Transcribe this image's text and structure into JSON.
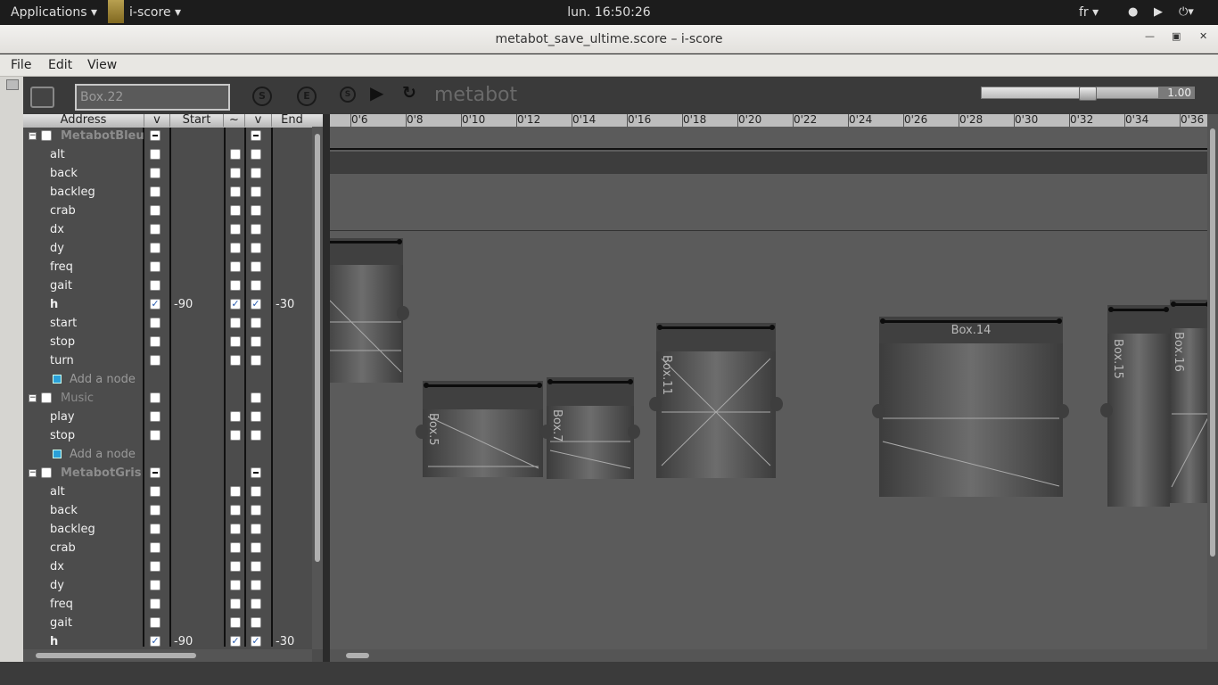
{
  "topbar": {
    "applications": "Applications ▾",
    "app_name": "i-score ▾",
    "clock": "lun. 16:50:26",
    "lang": "fr ▾",
    "icons": [
      "wifi-icon",
      "volume-icon",
      "power-icon"
    ]
  },
  "window": {
    "title": "metabot_save_ultime.score – i-score"
  },
  "menu": {
    "file": "File",
    "edit": "Edit",
    "view": "View"
  },
  "toolbar": {
    "box_name": "Box.22",
    "start_button": "S",
    "end_button": "E",
    "stop_button": "S",
    "project_title": "metabot",
    "zoom_value": "1.00",
    "zoom_level": 0.6
  },
  "tree": {
    "headers": {
      "address": "Address",
      "v1": "v",
      "start": "Start",
      "tilde": "~",
      "v2": "v",
      "end": "End"
    },
    "rows": [
      {
        "label": "MetabotBleu",
        "kind": "parent"
      },
      {
        "label": "alt",
        "kind": "child"
      },
      {
        "label": "back",
        "kind": "child"
      },
      {
        "label": "backleg",
        "kind": "child"
      },
      {
        "label": "crab",
        "kind": "child"
      },
      {
        "label": "dx",
        "kind": "child"
      },
      {
        "label": "dy",
        "kind": "child"
      },
      {
        "label": "freq",
        "kind": "child"
      },
      {
        "label": "gait",
        "kind": "child"
      },
      {
        "label": "h",
        "kind": "child-checked",
        "start": "-90",
        "end": "-30"
      },
      {
        "label": "start",
        "kind": "child"
      },
      {
        "label": "stop",
        "kind": "child"
      },
      {
        "label": "turn",
        "kind": "child"
      },
      {
        "label": "Add a node",
        "kind": "add"
      },
      {
        "label": "Music",
        "kind": "music"
      },
      {
        "label": "play",
        "kind": "child"
      },
      {
        "label": "stop",
        "kind": "child"
      },
      {
        "label": "Add a node",
        "kind": "add"
      },
      {
        "label": "MetabotGris",
        "kind": "parent"
      },
      {
        "label": "alt",
        "kind": "child"
      },
      {
        "label": "back",
        "kind": "child"
      },
      {
        "label": "backleg",
        "kind": "child"
      },
      {
        "label": "crab",
        "kind": "child"
      },
      {
        "label": "dx",
        "kind": "child"
      },
      {
        "label": "dy",
        "kind": "child"
      },
      {
        "label": "freq",
        "kind": "child"
      },
      {
        "label": "gait",
        "kind": "child"
      },
      {
        "label": "h",
        "kind": "child-checked",
        "start": "-90",
        "end": "-30"
      }
    ]
  },
  "timeline": {
    "ticks": [
      "0'6",
      "0'8",
      "0'10",
      "0'12",
      "0'14",
      "0'16",
      "0'18",
      "0'20",
      "0'22",
      "0'24",
      "0'26",
      "0'28",
      "0'30",
      "0'32",
      "0'34",
      "0'36"
    ],
    "boxes": [
      "Box.5",
      "Box.7",
      "Box.11",
      "Box.14",
      "Box.15",
      "Box.16"
    ]
  }
}
